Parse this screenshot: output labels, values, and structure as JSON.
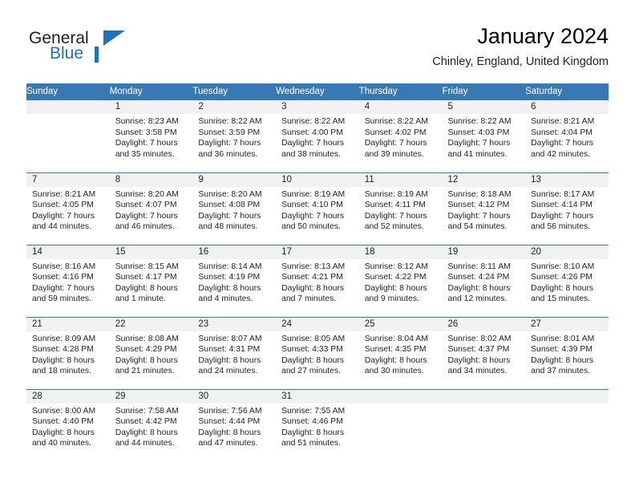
{
  "brand": {
    "name_part1": "General",
    "name_part2": "Blue",
    "accent_color": "#1e72b8"
  },
  "header": {
    "title": "January 2024",
    "subtitle": "Chinley, England, United Kingdom"
  },
  "calendar": {
    "header_bg_color": "#3878b4",
    "daynum_band_color": "#f1f1f1",
    "weekday_headers": [
      "Sunday",
      "Monday",
      "Tuesday",
      "Wednesday",
      "Thursday",
      "Friday",
      "Saturday"
    ],
    "weeks": [
      [
        {
          "day": "",
          "empty": true,
          "sunrise": "",
          "sunset": "",
          "daylight_line1": "",
          "daylight_line2": ""
        },
        {
          "day": "1",
          "empty": false,
          "sunrise": "Sunrise: 8:23 AM",
          "sunset": "Sunset: 3:58 PM",
          "daylight_line1": "Daylight: 7 hours",
          "daylight_line2": "and 35 minutes."
        },
        {
          "day": "2",
          "empty": false,
          "sunrise": "Sunrise: 8:22 AM",
          "sunset": "Sunset: 3:59 PM",
          "daylight_line1": "Daylight: 7 hours",
          "daylight_line2": "and 36 minutes."
        },
        {
          "day": "3",
          "empty": false,
          "sunrise": "Sunrise: 8:22 AM",
          "sunset": "Sunset: 4:00 PM",
          "daylight_line1": "Daylight: 7 hours",
          "daylight_line2": "and 38 minutes."
        },
        {
          "day": "4",
          "empty": false,
          "sunrise": "Sunrise: 8:22 AM",
          "sunset": "Sunset: 4:02 PM",
          "daylight_line1": "Daylight: 7 hours",
          "daylight_line2": "and 39 minutes."
        },
        {
          "day": "5",
          "empty": false,
          "sunrise": "Sunrise: 8:22 AM",
          "sunset": "Sunset: 4:03 PM",
          "daylight_line1": "Daylight: 7 hours",
          "daylight_line2": "and 41 minutes."
        },
        {
          "day": "6",
          "empty": false,
          "sunrise": "Sunrise: 8:21 AM",
          "sunset": "Sunset: 4:04 PM",
          "daylight_line1": "Daylight: 7 hours",
          "daylight_line2": "and 42 minutes."
        }
      ],
      [
        {
          "day": "7",
          "empty": false,
          "sunrise": "Sunrise: 8:21 AM",
          "sunset": "Sunset: 4:05 PM",
          "daylight_line1": "Daylight: 7 hours",
          "daylight_line2": "and 44 minutes."
        },
        {
          "day": "8",
          "empty": false,
          "sunrise": "Sunrise: 8:20 AM",
          "sunset": "Sunset: 4:07 PM",
          "daylight_line1": "Daylight: 7 hours",
          "daylight_line2": "and 46 minutes."
        },
        {
          "day": "9",
          "empty": false,
          "sunrise": "Sunrise: 8:20 AM",
          "sunset": "Sunset: 4:08 PM",
          "daylight_line1": "Daylight: 7 hours",
          "daylight_line2": "and 48 minutes."
        },
        {
          "day": "10",
          "empty": false,
          "sunrise": "Sunrise: 8:19 AM",
          "sunset": "Sunset: 4:10 PM",
          "daylight_line1": "Daylight: 7 hours",
          "daylight_line2": "and 50 minutes."
        },
        {
          "day": "11",
          "empty": false,
          "sunrise": "Sunrise: 8:19 AM",
          "sunset": "Sunset: 4:11 PM",
          "daylight_line1": "Daylight: 7 hours",
          "daylight_line2": "and 52 minutes."
        },
        {
          "day": "12",
          "empty": false,
          "sunrise": "Sunrise: 8:18 AM",
          "sunset": "Sunset: 4:12 PM",
          "daylight_line1": "Daylight: 7 hours",
          "daylight_line2": "and 54 minutes."
        },
        {
          "day": "13",
          "empty": false,
          "sunrise": "Sunrise: 8:17 AM",
          "sunset": "Sunset: 4:14 PM",
          "daylight_line1": "Daylight: 7 hours",
          "daylight_line2": "and 56 minutes."
        }
      ],
      [
        {
          "day": "14",
          "empty": false,
          "sunrise": "Sunrise: 8:16 AM",
          "sunset": "Sunset: 4:16 PM",
          "daylight_line1": "Daylight: 7 hours",
          "daylight_line2": "and 59 minutes."
        },
        {
          "day": "15",
          "empty": false,
          "sunrise": "Sunrise: 8:15 AM",
          "sunset": "Sunset: 4:17 PM",
          "daylight_line1": "Daylight: 8 hours",
          "daylight_line2": "and 1 minute."
        },
        {
          "day": "16",
          "empty": false,
          "sunrise": "Sunrise: 8:14 AM",
          "sunset": "Sunset: 4:19 PM",
          "daylight_line1": "Daylight: 8 hours",
          "daylight_line2": "and 4 minutes."
        },
        {
          "day": "17",
          "empty": false,
          "sunrise": "Sunrise: 8:13 AM",
          "sunset": "Sunset: 4:21 PM",
          "daylight_line1": "Daylight: 8 hours",
          "daylight_line2": "and 7 minutes."
        },
        {
          "day": "18",
          "empty": false,
          "sunrise": "Sunrise: 8:12 AM",
          "sunset": "Sunset: 4:22 PM",
          "daylight_line1": "Daylight: 8 hours",
          "daylight_line2": "and 9 minutes."
        },
        {
          "day": "19",
          "empty": false,
          "sunrise": "Sunrise: 8:11 AM",
          "sunset": "Sunset: 4:24 PM",
          "daylight_line1": "Daylight: 8 hours",
          "daylight_line2": "and 12 minutes."
        },
        {
          "day": "20",
          "empty": false,
          "sunrise": "Sunrise: 8:10 AM",
          "sunset": "Sunset: 4:26 PM",
          "daylight_line1": "Daylight: 8 hours",
          "daylight_line2": "and 15 minutes."
        }
      ],
      [
        {
          "day": "21",
          "empty": false,
          "sunrise": "Sunrise: 8:09 AM",
          "sunset": "Sunset: 4:28 PM",
          "daylight_line1": "Daylight: 8 hours",
          "daylight_line2": "and 18 minutes."
        },
        {
          "day": "22",
          "empty": false,
          "sunrise": "Sunrise: 8:08 AM",
          "sunset": "Sunset: 4:29 PM",
          "daylight_line1": "Daylight: 8 hours",
          "daylight_line2": "and 21 minutes."
        },
        {
          "day": "23",
          "empty": false,
          "sunrise": "Sunrise: 8:07 AM",
          "sunset": "Sunset: 4:31 PM",
          "daylight_line1": "Daylight: 8 hours",
          "daylight_line2": "and 24 minutes."
        },
        {
          "day": "24",
          "empty": false,
          "sunrise": "Sunrise: 8:05 AM",
          "sunset": "Sunset: 4:33 PM",
          "daylight_line1": "Daylight: 8 hours",
          "daylight_line2": "and 27 minutes."
        },
        {
          "day": "25",
          "empty": false,
          "sunrise": "Sunrise: 8:04 AM",
          "sunset": "Sunset: 4:35 PM",
          "daylight_line1": "Daylight: 8 hours",
          "daylight_line2": "and 30 minutes."
        },
        {
          "day": "26",
          "empty": false,
          "sunrise": "Sunrise: 8:02 AM",
          "sunset": "Sunset: 4:37 PM",
          "daylight_line1": "Daylight: 8 hours",
          "daylight_line2": "and 34 minutes."
        },
        {
          "day": "27",
          "empty": false,
          "sunrise": "Sunrise: 8:01 AM",
          "sunset": "Sunset: 4:39 PM",
          "daylight_line1": "Daylight: 8 hours",
          "daylight_line2": "and 37 minutes."
        }
      ],
      [
        {
          "day": "28",
          "empty": false,
          "sunrise": "Sunrise: 8:00 AM",
          "sunset": "Sunset: 4:40 PM",
          "daylight_line1": "Daylight: 8 hours",
          "daylight_line2": "and 40 minutes."
        },
        {
          "day": "29",
          "empty": false,
          "sunrise": "Sunrise: 7:58 AM",
          "sunset": "Sunset: 4:42 PM",
          "daylight_line1": "Daylight: 8 hours",
          "daylight_line2": "and 44 minutes."
        },
        {
          "day": "30",
          "empty": false,
          "sunrise": "Sunrise: 7:56 AM",
          "sunset": "Sunset: 4:44 PM",
          "daylight_line1": "Daylight: 8 hours",
          "daylight_line2": "and 47 minutes."
        },
        {
          "day": "31",
          "empty": false,
          "sunrise": "Sunrise: 7:55 AM",
          "sunset": "Sunset: 4:46 PM",
          "daylight_line1": "Daylight: 8 hours",
          "daylight_line2": "and 51 minutes."
        },
        {
          "day": "",
          "empty": true,
          "sunrise": "",
          "sunset": "",
          "daylight_line1": "",
          "daylight_line2": ""
        },
        {
          "day": "",
          "empty": true,
          "sunrise": "",
          "sunset": "",
          "daylight_line1": "",
          "daylight_line2": ""
        },
        {
          "day": "",
          "empty": true,
          "sunrise": "",
          "sunset": "",
          "daylight_line1": "",
          "daylight_line2": ""
        }
      ]
    ]
  }
}
